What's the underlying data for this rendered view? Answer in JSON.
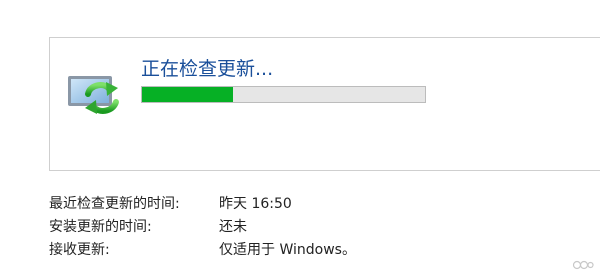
{
  "update": {
    "status": "正在检查更新...",
    "progress_percent": 32
  },
  "info": [
    {
      "label": "最近检查更新的时间:",
      "value": "昨天 16:50"
    },
    {
      "label": "安装更新的时间:",
      "value": "还未"
    },
    {
      "label": "接收更新:",
      "value": "仅适用于 Windows。"
    }
  ],
  "icons": {
    "update": "windows-update-icon"
  },
  "colors": {
    "title": "#1a4f9a",
    "progress_fill": "#06b025",
    "progress_track": "#e6e6e6"
  }
}
